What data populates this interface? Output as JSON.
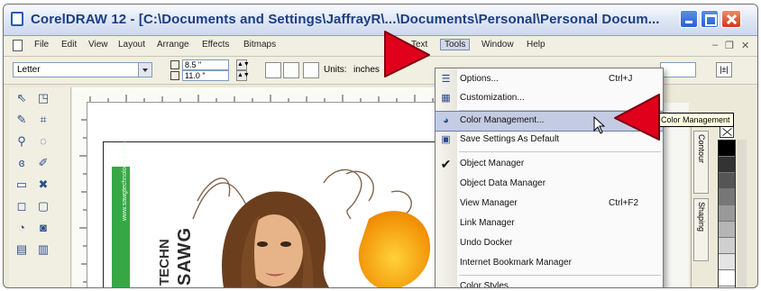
{
  "window": {
    "title": "CorelDRAW 12 - [C:\\Documents and Settings\\JaffrayR\\...\\Documents\\Personal\\Personal Docum...",
    "controls": {
      "minimize": "minimize",
      "maximize": "maximize",
      "close": "close"
    }
  },
  "menubar": {
    "items": [
      "File",
      "Edit",
      "View",
      "Layout",
      "Arrange",
      "Effects",
      "Bitmaps",
      "Text",
      "Tools",
      "Window",
      "Help"
    ],
    "active": "Tools"
  },
  "property_bar": {
    "paper_size": "Letter",
    "width": "8.5 \"",
    "height": "11.0 \"",
    "units_label": "Units:",
    "units_value": "inches"
  },
  "tools_menu": {
    "items": [
      {
        "label": "Options...",
        "shortcut": "Ctrl+J",
        "icon": "options-icon"
      },
      {
        "label": "Customization...",
        "shortcut": "",
        "icon": "customization-icon"
      },
      {
        "label": "Color Management...",
        "shortcut": "",
        "icon": "color-management-icon",
        "highlighted": true
      },
      {
        "label": "Save Settings As Default",
        "shortcut": "",
        "icon": "save-settings-icon"
      },
      {
        "label": "Object Manager",
        "shortcut": "",
        "icon": "checkmark-icon",
        "checked": true
      },
      {
        "label": "Object Data Manager",
        "shortcut": ""
      },
      {
        "label": "View Manager",
        "shortcut": "Ctrl+F2"
      },
      {
        "label": "Link Manager",
        "shortcut": ""
      },
      {
        "label": "Undo Docker",
        "shortcut": ""
      },
      {
        "label": "Internet Bookmark Manager",
        "shortcut": ""
      },
      {
        "label": "Color Styles",
        "shortcut": ""
      }
    ]
  },
  "tooltip": {
    "text": "Color Management"
  },
  "dockers": {
    "tabs": [
      "Contour",
      "Shaping"
    ]
  },
  "artwork": {
    "brand_text": "SAWG",
    "brand_sub": "TECHN",
    "vertical_url": "www.sawgtechnologies.com"
  },
  "colors": {
    "accent_red": "#e0001b",
    "menu_highlight": "#c4cce4",
    "title_text": "#1d3e80",
    "brand_green": "#35a845"
  }
}
